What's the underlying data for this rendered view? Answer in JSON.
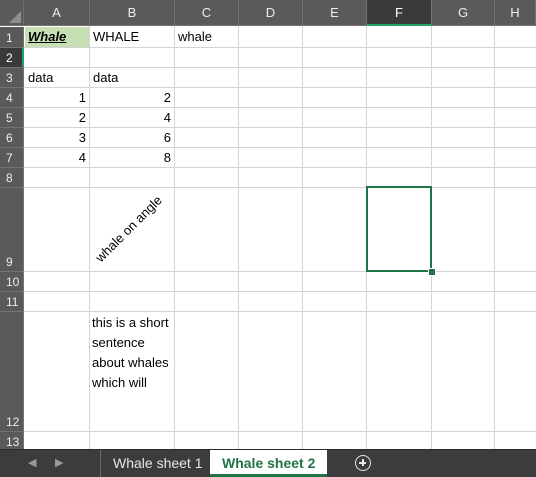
{
  "columns": [
    "A",
    "B",
    "C",
    "D",
    "E",
    "F",
    "G",
    "H"
  ],
  "rows": [
    "1",
    "2",
    "3",
    "4",
    "5",
    "6",
    "7",
    "8",
    "9",
    "10",
    "11",
    "12",
    "13"
  ],
  "selected_column": "F",
  "selected_row": "2",
  "cells": {
    "A1": "Whale",
    "B1": "WHALE",
    "C1": "whale",
    "A3": "data",
    "B3": "data",
    "A4": "1",
    "B4": "2",
    "A5": "2",
    "B5": "4",
    "A6": "3",
    "B6": "6",
    "A7": "4",
    "B7": "8",
    "B9": "whale on angle",
    "B12": "this is a short sentence about whales which will"
  },
  "sheet_tabs": [
    "Whale sheet 1",
    "Whale sheet 2"
  ],
  "active_sheet": "Whale sheet 2",
  "colors": {
    "accent": "#217346",
    "title_fill": "#c6e0b4",
    "header_bg": "#5a5a5a"
  }
}
